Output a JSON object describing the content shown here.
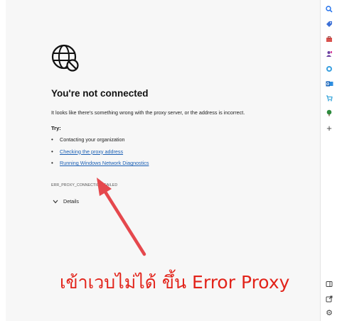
{
  "error_page": {
    "title": "You're not connected",
    "description": "It looks like there's something wrong with the proxy server, or the address is incorrect.",
    "try_label": "Try:",
    "suggestions": [
      "Contacting your organization",
      "Checking the proxy address",
      "Running Windows Network Diagnostics"
    ],
    "error_code": "ERR_PROXY_CONNECTION_FAILED",
    "details_label": "Details"
  },
  "annotation": {
    "caption": "เข้าเวบไม่ได้ ขึ้น Error Proxy",
    "color": "#e2231a",
    "arrow_color": "#e5484d"
  },
  "sidebar": {
    "icons": [
      "search-icon",
      "tag-icon",
      "toolbox-icon",
      "person-icon",
      "copilot-icon",
      "outlook-icon",
      "shopping-icon",
      "tree-icon",
      "add-icon",
      "split-screen-icon",
      "external-link-icon",
      "settings-icon"
    ]
  }
}
